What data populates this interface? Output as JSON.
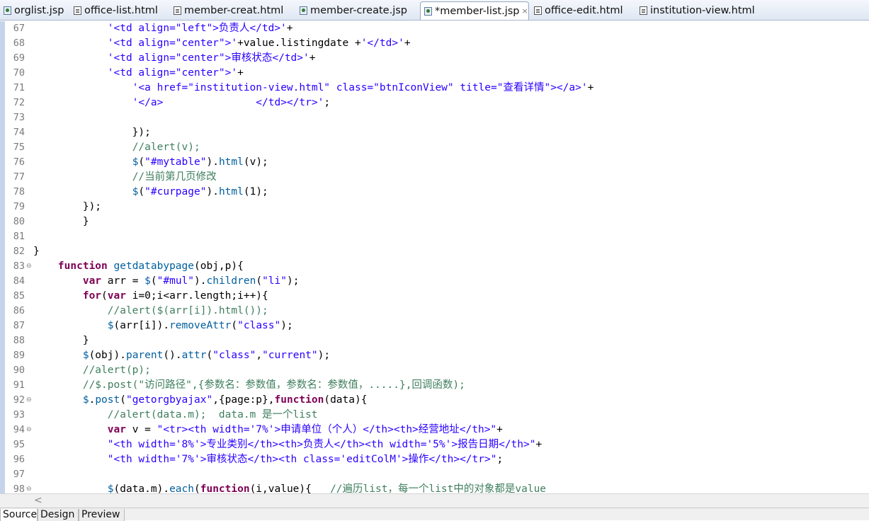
{
  "editor_tabs": [
    {
      "label": "orglist.jsp",
      "icon": "jsp-file-icon",
      "active": false
    },
    {
      "label": "office-list.html",
      "icon": "html-file-icon",
      "active": false
    },
    {
      "label": "member-creat.html",
      "icon": "html-file-icon",
      "active": false
    },
    {
      "label": "member-create.jsp",
      "icon": "jsp-file-icon",
      "active": false
    },
    {
      "label": "*member-list.jsp",
      "icon": "jsp-file-icon",
      "active": true
    },
    {
      "label": "office-edit.html",
      "icon": "html-file-icon",
      "active": false
    },
    {
      "label": "institution-view.html",
      "icon": "html-file-icon",
      "active": false
    }
  ],
  "active_tab_close": "×",
  "code_lines": [
    {
      "n": "67",
      "fold": false,
      "spans": [
        [
          "",
          "            "
        ],
        [
          "str",
          "'<td align=\"left\">负责人</td>'"
        ],
        [
          "",
          "+"
        ]
      ]
    },
    {
      "n": "68",
      "fold": false,
      "spans": [
        [
          "",
          "            "
        ],
        [
          "str",
          "'<td align=\"center\">'"
        ],
        [
          "",
          "+value.listingdate +"
        ],
        [
          "str",
          "'</td>'"
        ],
        [
          "",
          "+"
        ]
      ]
    },
    {
      "n": "69",
      "fold": false,
      "spans": [
        [
          "",
          "            "
        ],
        [
          "str",
          "'<td align=\"center\">审核状态</td>'"
        ],
        [
          "",
          "+"
        ]
      ]
    },
    {
      "n": "70",
      "fold": false,
      "spans": [
        [
          "",
          "            "
        ],
        [
          "str",
          "'<td align=\"center\">'"
        ],
        [
          "",
          "+"
        ]
      ]
    },
    {
      "n": "71",
      "fold": false,
      "spans": [
        [
          "",
          "                "
        ],
        [
          "str",
          "'<a href=\"institution-view.html\" class=\"btnIconView\" title=\"查看详情\"></a>'"
        ],
        [
          "",
          "+"
        ]
      ]
    },
    {
      "n": "72",
      "fold": false,
      "spans": [
        [
          "",
          "                "
        ],
        [
          "str",
          "'</a>               </td></tr>'"
        ],
        [
          "",
          ";"
        ]
      ]
    },
    {
      "n": "73",
      "fold": false,
      "spans": [
        [
          "",
          ""
        ]
      ]
    },
    {
      "n": "74",
      "fold": false,
      "spans": [
        [
          "",
          "                });"
        ]
      ]
    },
    {
      "n": "75",
      "fold": false,
      "spans": [
        [
          "",
          "                "
        ],
        [
          "cmt",
          "//alert(v);"
        ]
      ]
    },
    {
      "n": "76",
      "fold": false,
      "spans": [
        [
          "",
          "                "
        ],
        [
          "fn",
          "$"
        ],
        [
          "",
          "("
        ],
        [
          "str",
          "\"#mytable\""
        ],
        [
          "",
          ")."
        ],
        [
          "fn",
          "html"
        ],
        [
          "",
          "(v);"
        ]
      ]
    },
    {
      "n": "77",
      "fold": false,
      "spans": [
        [
          "",
          "                "
        ],
        [
          "cmt",
          "//当前第几页修改"
        ]
      ]
    },
    {
      "n": "78",
      "fold": false,
      "spans": [
        [
          "",
          "                "
        ],
        [
          "fn",
          "$"
        ],
        [
          "",
          "("
        ],
        [
          "str",
          "\"#curpage\""
        ],
        [
          "",
          ")."
        ],
        [
          "fn",
          "html"
        ],
        [
          "",
          "(1);"
        ]
      ]
    },
    {
      "n": "79",
      "fold": false,
      "spans": [
        [
          "",
          "        });"
        ]
      ]
    },
    {
      "n": "80",
      "fold": false,
      "spans": [
        [
          "",
          "        }"
        ]
      ]
    },
    {
      "n": "81",
      "fold": false,
      "spans": [
        [
          "",
          ""
        ]
      ]
    },
    {
      "n": "82",
      "fold": false,
      "spans": [
        [
          "",
          "}"
        ]
      ]
    },
    {
      "n": "83",
      "fold": true,
      "spans": [
        [
          "",
          "    "
        ],
        [
          "kw",
          "function"
        ],
        [
          "",
          " "
        ],
        [
          "fn",
          "getdatabypage"
        ],
        [
          "",
          "(obj,p){"
        ]
      ]
    },
    {
      "n": "84",
      "fold": false,
      "spans": [
        [
          "",
          "        "
        ],
        [
          "kw",
          "var"
        ],
        [
          "",
          " arr = "
        ],
        [
          "fn",
          "$"
        ],
        [
          "",
          "("
        ],
        [
          "str",
          "\"#mul\""
        ],
        [
          "",
          ")."
        ],
        [
          "fn",
          "children"
        ],
        [
          "",
          "("
        ],
        [
          "str",
          "\"li\""
        ],
        [
          "",
          ");"
        ]
      ]
    },
    {
      "n": "85",
      "fold": false,
      "spans": [
        [
          "",
          "        "
        ],
        [
          "kw",
          "for"
        ],
        [
          "",
          "("
        ],
        [
          "kw",
          "var"
        ],
        [
          "",
          " i=0;i<arr.length;i++){"
        ]
      ]
    },
    {
      "n": "86",
      "fold": false,
      "spans": [
        [
          "",
          "            "
        ],
        [
          "cmt",
          "//alert($(arr[i]).html());"
        ]
      ]
    },
    {
      "n": "87",
      "fold": false,
      "spans": [
        [
          "",
          "            "
        ],
        [
          "fn",
          "$"
        ],
        [
          "",
          "(arr[i])."
        ],
        [
          "fn",
          "removeAttr"
        ],
        [
          "",
          "("
        ],
        [
          "str",
          "\"class\""
        ],
        [
          "",
          ");"
        ]
      ]
    },
    {
      "n": "88",
      "fold": false,
      "spans": [
        [
          "",
          "        }"
        ]
      ]
    },
    {
      "n": "89",
      "fold": false,
      "spans": [
        [
          "",
          "        "
        ],
        [
          "fn",
          "$"
        ],
        [
          "",
          "(obj)."
        ],
        [
          "fn",
          "parent"
        ],
        [
          "",
          "()."
        ],
        [
          "fn",
          "attr"
        ],
        [
          "",
          "("
        ],
        [
          "str",
          "\"class\""
        ],
        [
          "",
          ","
        ],
        [
          "str",
          "\"current\""
        ],
        [
          "",
          ");"
        ]
      ]
    },
    {
      "n": "90",
      "fold": false,
      "spans": [
        [
          "",
          "        "
        ],
        [
          "cmt",
          "//alert(p);"
        ]
      ]
    },
    {
      "n": "91",
      "fold": false,
      "spans": [
        [
          "",
          "        "
        ],
        [
          "cmt",
          "//$.post(\"访问路径\",{参数名：参数值，参数名：参数值，.....},回调函数);"
        ]
      ]
    },
    {
      "n": "92",
      "fold": true,
      "spans": [
        [
          "",
          "        "
        ],
        [
          "fn",
          "$"
        ],
        [
          "",
          "."
        ],
        [
          "fn",
          "post"
        ],
        [
          "",
          "("
        ],
        [
          "str",
          "\"getorgbyajax\""
        ],
        [
          "",
          ",{page:p},"
        ],
        [
          "kw",
          "function"
        ],
        [
          "",
          "(data){"
        ]
      ]
    },
    {
      "n": "93",
      "fold": false,
      "spans": [
        [
          "",
          "            "
        ],
        [
          "cmt",
          "//alert(data.m);  data.m 是一个list"
        ]
      ]
    },
    {
      "n": "94",
      "fold": true,
      "spans": [
        [
          "",
          "            "
        ],
        [
          "kw",
          "var"
        ],
        [
          "",
          " v = "
        ],
        [
          "str",
          "\"<tr><th width='7%'>申请单位（个人）</th><th>经营地址</th>\""
        ],
        [
          "",
          "+"
        ]
      ]
    },
    {
      "n": "95",
      "fold": false,
      "spans": [
        [
          "",
          "            "
        ],
        [
          "str",
          "\"<th width='8%'>专业类别</th><th>负责人</th><th width='5%'>报告日期</th>\""
        ],
        [
          "",
          "+"
        ]
      ]
    },
    {
      "n": "96",
      "fold": false,
      "spans": [
        [
          "",
          "            "
        ],
        [
          "str",
          "\"<th width='7%'>审核状态</th><th class='editColM'>操作</th></tr>\""
        ],
        [
          "",
          ";"
        ]
      ]
    },
    {
      "n": "97",
      "fold": false,
      "spans": [
        [
          "",
          ""
        ]
      ]
    },
    {
      "n": "98",
      "fold": true,
      "spans": [
        [
          "",
          "            "
        ],
        [
          "fn",
          "$"
        ],
        [
          "",
          "(data.m)."
        ],
        [
          "fn",
          "each"
        ],
        [
          "",
          "("
        ],
        [
          "kw",
          "function"
        ],
        [
          "",
          "(i,value){   "
        ],
        [
          "cmt",
          "//遍历list，每一个list中的对象都是value"
        ]
      ]
    }
  ],
  "scrollbar": {
    "left_arrow": "<"
  },
  "bottom_tabs": [
    {
      "label": "Source",
      "active": true
    },
    {
      "label": "Design",
      "active": false
    },
    {
      "label": "Preview",
      "active": false
    }
  ]
}
